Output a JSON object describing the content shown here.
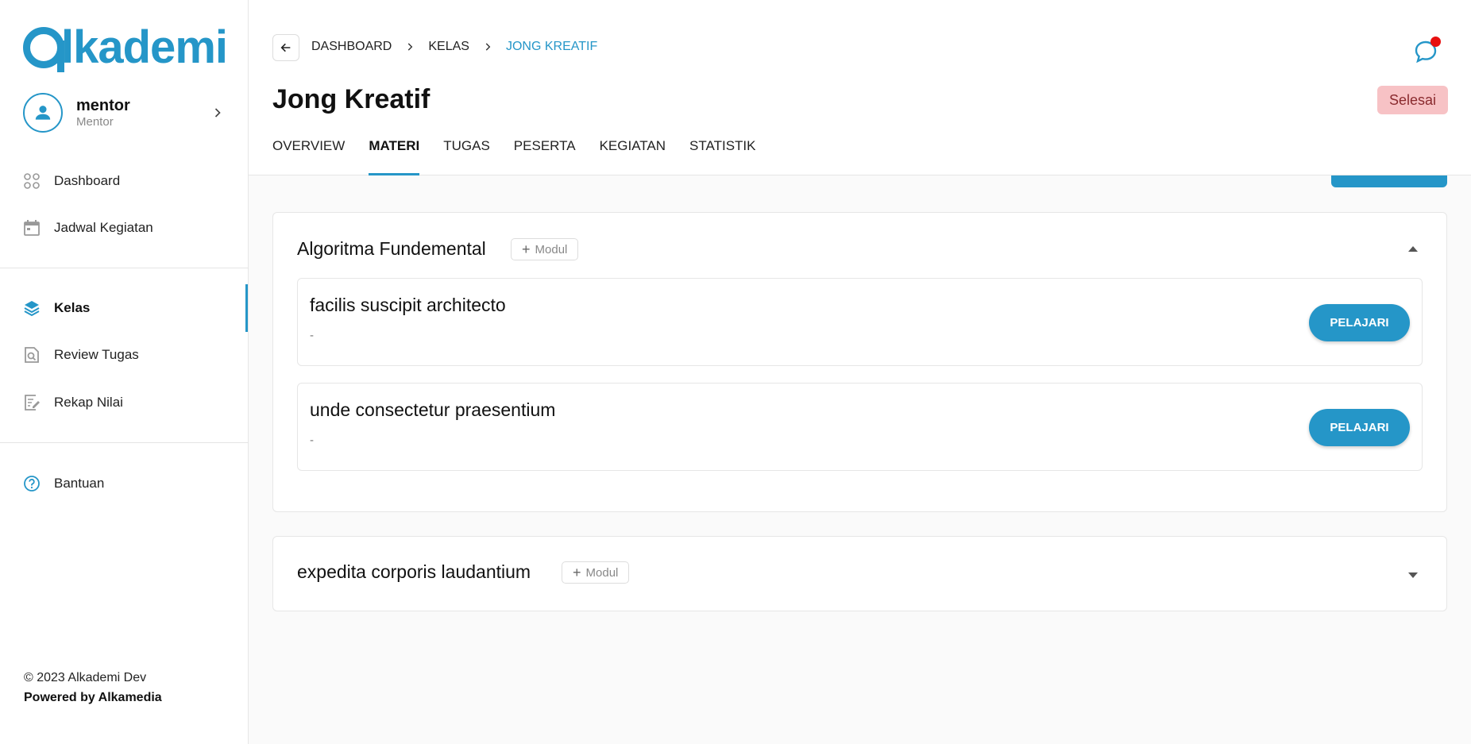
{
  "brand": {
    "logo_text": "lkademi",
    "color": "#2596c8"
  },
  "user": {
    "name": "mentor",
    "role": "Mentor"
  },
  "sidebar": {
    "items": [
      {
        "label": "Dashboard",
        "icon": "grid-icon"
      },
      {
        "label": "Jadwal Kegiatan",
        "icon": "calendar-icon"
      },
      {
        "label": "Kelas",
        "icon": "layers-icon",
        "active": true
      },
      {
        "label": "Review Tugas",
        "icon": "review-icon"
      },
      {
        "label": "Rekap Nilai",
        "icon": "edit-note-icon"
      },
      {
        "label": "Bantuan",
        "icon": "help-icon"
      }
    ],
    "copyright": "© 2023 Alkademi Dev",
    "powered": "Powered by Alkamedia"
  },
  "breadcrumb": [
    "DASHBOARD",
    "KELAS",
    "JONG KREATIF"
  ],
  "page": {
    "title": "Jong Kreatif",
    "status": "Selesai"
  },
  "tabs": [
    {
      "label": "OVERVIEW"
    },
    {
      "label": "MATERI",
      "active": true
    },
    {
      "label": "TUGAS"
    },
    {
      "label": "PESERTA"
    },
    {
      "label": "KEGIATAN"
    },
    {
      "label": "STATISTIK"
    }
  ],
  "sections": [
    {
      "title": "Algoritma Fundemental",
      "add_label": "Modul",
      "expanded": true,
      "modules": [
        {
          "title": "facilis suscipit architecto",
          "desc": "-",
          "button": "PELAJARI"
        },
        {
          "title": "unde consectetur praesentium",
          "desc": "-",
          "button": "PELAJARI"
        }
      ]
    },
    {
      "title": "expedita corporis laudantium",
      "add_label": "Modul",
      "expanded": false,
      "modules": []
    }
  ],
  "colors": {
    "accent": "#2596c8",
    "status_bg": "#f7c2c5",
    "notification_dot": "#e81010"
  }
}
